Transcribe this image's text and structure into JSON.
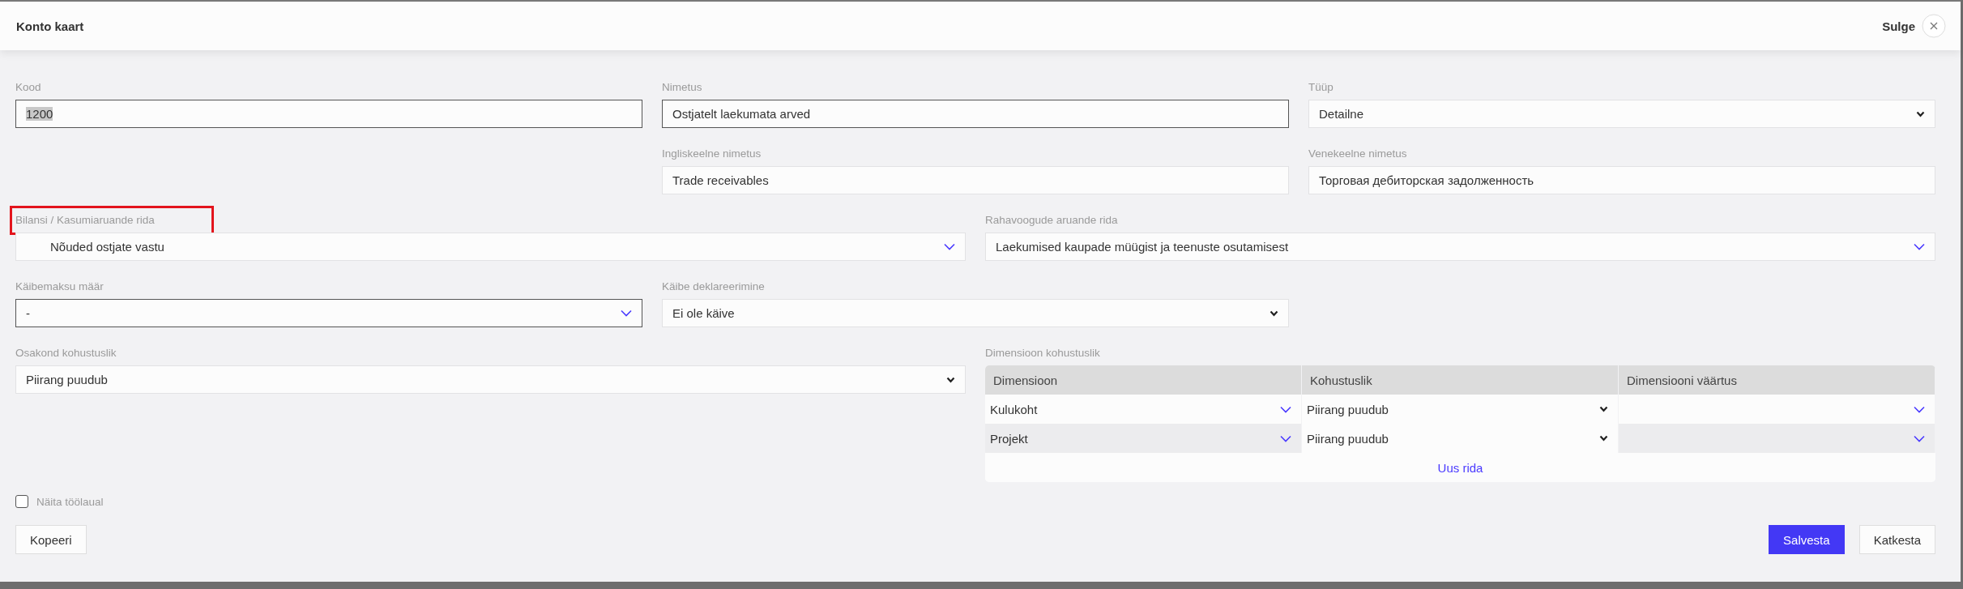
{
  "window": {
    "title": "Konto kaart",
    "close_label": "Sulge"
  },
  "fields": [
    {
      "label": "Kood",
      "kind": "text",
      "value": "1200",
      "text_selected": true,
      "bordered": true
    },
    {
      "label": "Nimetus",
      "kind": "text",
      "value": "Ostjatelt laekumata arved",
      "bordered": true
    },
    {
      "label": "Tüüp",
      "kind": "select",
      "value": "Detailne"
    },
    {
      "label": "Ingliskeelne nimetus",
      "kind": "text",
      "value": "Trade receivables"
    },
    {
      "label": "Venekeelne nimetus",
      "kind": "text",
      "value": "Торговая дебиторская задолженность"
    },
    {
      "label": "Bilansi / Kasumiaruande rida",
      "kind": "combo",
      "value": "Nõuded ostjate vastu",
      "highlighted": true,
      "indented": true
    },
    {
      "label": "Rahavoogude aruande rida",
      "kind": "combo",
      "value": "Laekumised kaupade müügist ja teenuste osutamisest"
    },
    {
      "label": "Käibemaksu määr",
      "kind": "combo",
      "value": "-",
      "bordered": true
    },
    {
      "label": "Käibe deklareerimine",
      "kind": "select",
      "value": "Ei ole käive"
    },
    {
      "label": "Osakond kohustuslik",
      "kind": "select",
      "value": "Piirang puudub"
    }
  ],
  "dimensions": {
    "label": "Dimensioon kohustuslik",
    "columns": [
      "Dimensioon",
      "Kohustuslik",
      "Dimensiooni väärtus"
    ],
    "rows": [
      [
        {
          "kind": "combo",
          "value": "Kulukoht"
        },
        {
          "kind": "select",
          "value": "Piirang puudub"
        },
        {
          "kind": "combo"
        }
      ],
      [
        {
          "kind": "combo",
          "value": "Projekt"
        },
        {
          "kind": "select",
          "value": "Piirang puudub"
        },
        {
          "kind": "combo"
        }
      ]
    ],
    "add_row": "Uus rida"
  },
  "checkbox": {
    "label": "Näita töölaual",
    "checked": false
  },
  "buttons": [
    {
      "label": "Kopeeri",
      "kind": "secondary"
    },
    {
      "label": "Salvesta",
      "kind": "primary"
    },
    {
      "label": "Katkesta",
      "kind": "secondary"
    }
  ]
}
